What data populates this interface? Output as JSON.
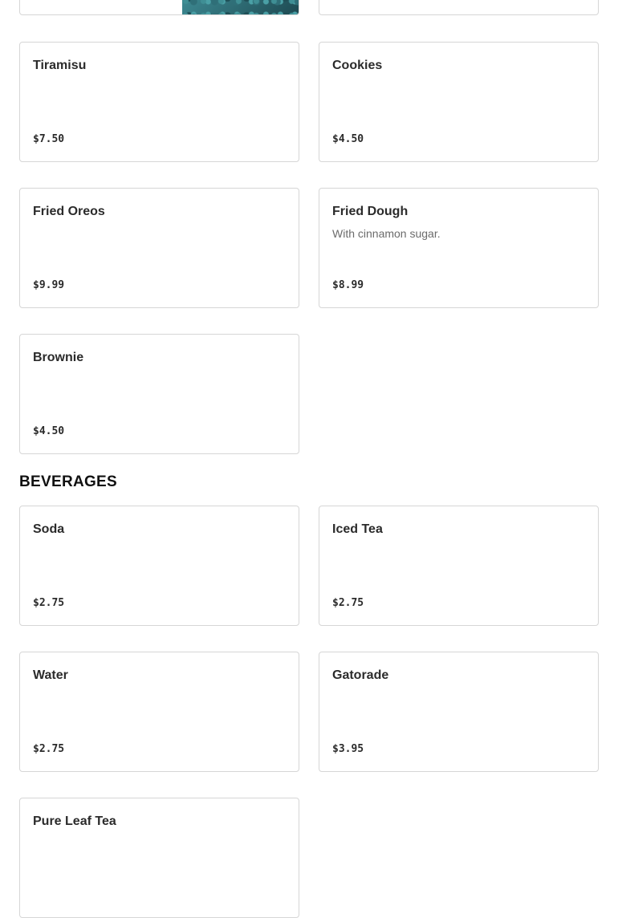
{
  "desserts": {
    "items": [
      {
        "name": "Tiramisu",
        "description": "",
        "price": "$7.50"
      },
      {
        "name": "Cookies",
        "description": "",
        "price": "$4.50"
      },
      {
        "name": "Fried Oreos",
        "description": "",
        "price": "$9.99"
      },
      {
        "name": "Fried Dough",
        "description": "With cinnamon sugar.",
        "price": "$8.99"
      },
      {
        "name": "Brownie",
        "description": "",
        "price": "$4.50"
      }
    ]
  },
  "beverages": {
    "heading": "BEVERAGES",
    "items": [
      {
        "name": "Soda",
        "description": "",
        "price": "$2.75"
      },
      {
        "name": "Iced Tea",
        "description": "",
        "price": "$2.75"
      },
      {
        "name": "Water",
        "description": "",
        "price": "$2.75"
      },
      {
        "name": "Gatorade",
        "description": "",
        "price": "$3.95"
      },
      {
        "name": "Pure Leaf Tea",
        "description": "",
        "price": ""
      }
    ]
  }
}
